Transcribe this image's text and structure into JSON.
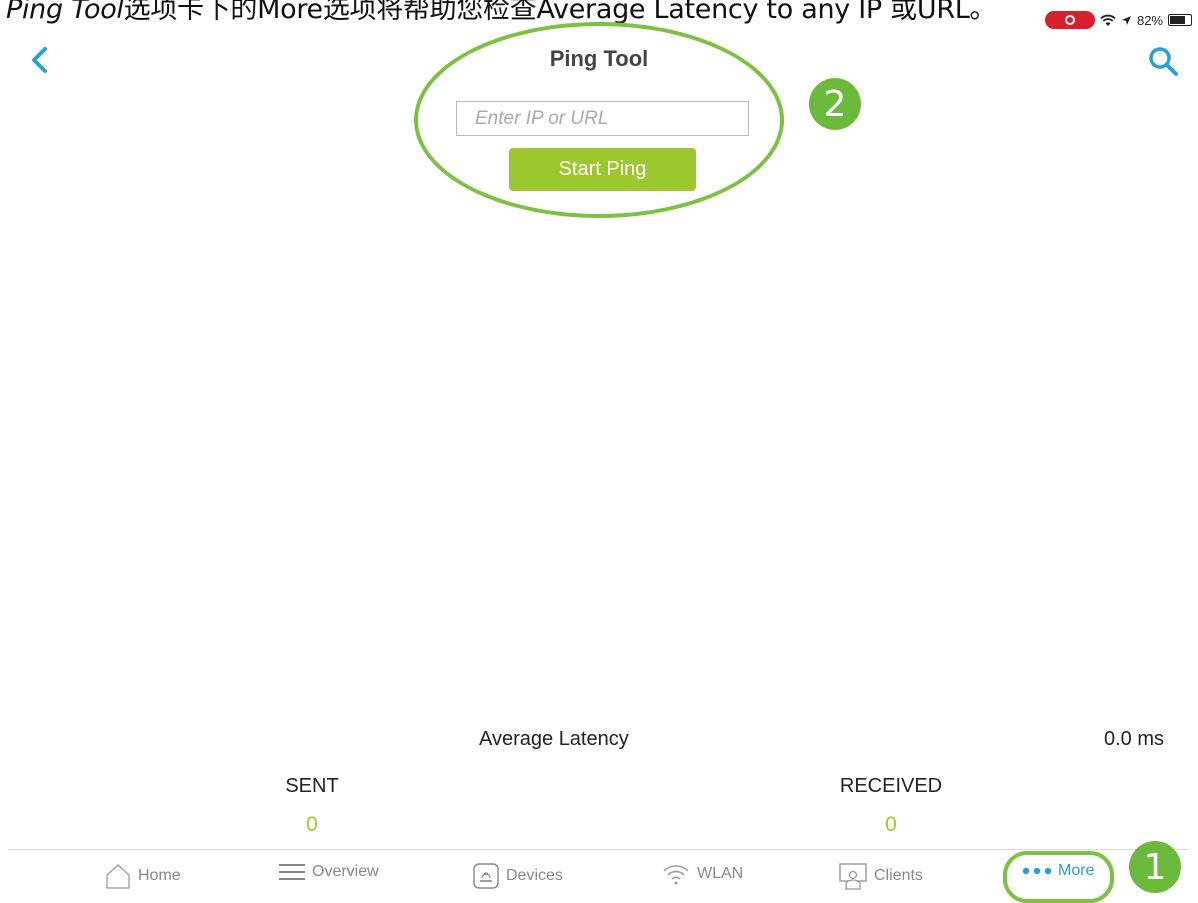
{
  "caption": {
    "italic_part": "Ping Tool",
    "rest": "选项卡下的More选项将帮助您检查Average Latency to any IP 或URL。"
  },
  "status_bar": {
    "battery": "82%",
    "battery_level": 0.82
  },
  "header": {
    "title": "Ping Tool"
  },
  "ping": {
    "input_placeholder": "Enter IP or URL",
    "input_value": "",
    "start_label": "Start Ping"
  },
  "annotations": {
    "badge_1": "1",
    "badge_2": "2"
  },
  "stats": {
    "latency_label": "Average Latency",
    "latency_value": "0.0 ms",
    "sent_label": "SENT",
    "sent_value": "0",
    "received_label": "RECEIVED",
    "received_value": "0"
  },
  "tabbar": {
    "home": "Home",
    "overview": "Overview",
    "devices": "Devices",
    "wlan": "WLAN",
    "clients": "Clients",
    "more": "More"
  },
  "colors": {
    "accent_blue": "#2a9fd6",
    "accent_green": "#9dc72e",
    "annotation_green": "#7cc142",
    "record_red": "#d81f2b"
  }
}
